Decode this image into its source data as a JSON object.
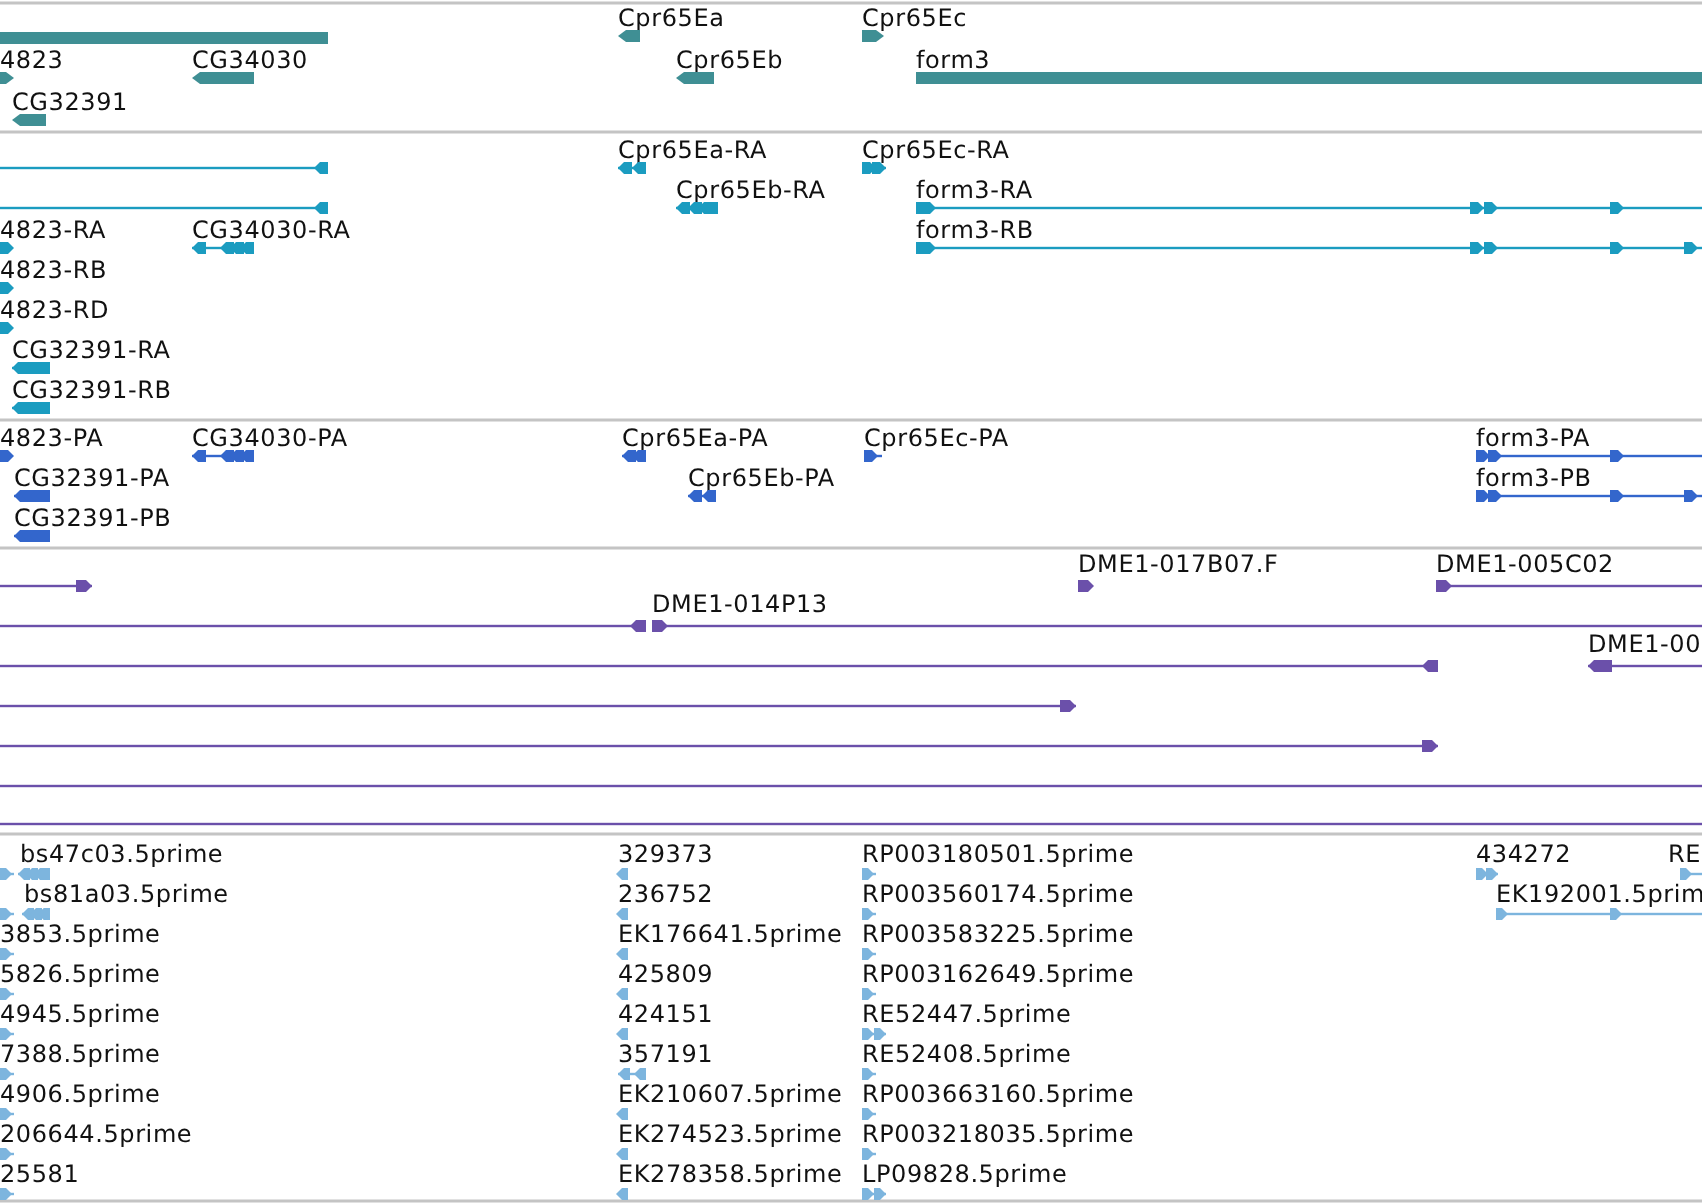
{
  "tracks": [
    {
      "kind": "gene",
      "features": [
        {
          "kind": "plain"
        },
        {
          "label": "4823",
          "kind": "forward"
        },
        {
          "label": "CG34030",
          "kind": "reverse"
        },
        {
          "label": "CG32391",
          "kind": "reverse"
        },
        {
          "label": "Cpr65Ea",
          "kind": "reverse"
        },
        {
          "label": "Cpr65Eb",
          "kind": "reverse"
        },
        {
          "label": "Cpr65Ec",
          "kind": "forward"
        },
        {
          "label": "form3",
          "kind": "plain"
        }
      ]
    },
    {
      "kind": "transcript",
      "features": [
        {
          "kind": "reverse"
        },
        {
          "kind": "reverse"
        },
        {
          "label": "4823-RA",
          "kind": "forward"
        },
        {
          "label": "CG34030-RA",
          "kind": "reverse"
        },
        {
          "label": "4823-RB",
          "kind": "forward"
        },
        {
          "label": "4823-RD",
          "kind": "forward"
        },
        {
          "label": "CG32391-RA",
          "kind": "reverse"
        },
        {
          "label": "CG32391-RB",
          "kind": "reverse"
        },
        {
          "label": "Cpr65Ea-RA",
          "kind": "reverse"
        },
        {
          "label": "Cpr65Eb-RA",
          "kind": "reverse"
        },
        {
          "label": "Cpr65Ec-RA",
          "kind": "forward"
        },
        {
          "label": "form3-RA",
          "kind": "forward"
        },
        {
          "label": "form3-RB",
          "kind": "forward"
        }
      ]
    },
    {
      "kind": "protein",
      "features": [
        {
          "label": "4823-PA",
          "kind": "forward"
        },
        {
          "label": "CG34030-PA",
          "kind": "reverse"
        },
        {
          "label": "CG32391-PA",
          "kind": "reverse"
        },
        {
          "label": "CG32391-PB",
          "kind": "reverse"
        },
        {
          "label": "Cpr65Ea-PA",
          "kind": "reverse"
        },
        {
          "label": "Cpr65Eb-PA",
          "kind": "reverse"
        },
        {
          "label": "Cpr65Ec-PA",
          "kind": "forward"
        },
        {
          "label": "form3-PA",
          "kind": "forward"
        },
        {
          "label": "form3-PB",
          "kind": "forward"
        }
      ]
    },
    {
      "kind": "clone",
      "features": [
        {
          "kind": "forward"
        },
        {
          "label": "DME1-017B07.F",
          "kind": "forward"
        },
        {
          "label": "DME1-005C02",
          "kind": "forward"
        },
        {
          "kind": "reverse"
        },
        {
          "label": "DME1-014P13",
          "kind": "forward"
        },
        {
          "kind": "reverse"
        },
        {
          "label": "DME1-00",
          "kind": "reverse"
        },
        {
          "kind": "forward"
        },
        {
          "kind": "forward"
        },
        {
          "kind": "plain"
        },
        {
          "kind": "plain"
        }
      ]
    },
    {
      "kind": "est",
      "features": [
        {
          "kind": "forward"
        },
        {
          "label": "bs47c03.5prime",
          "kind": "reverse"
        },
        {
          "kind": "forward"
        },
        {
          "label": "bs81a03.5prime",
          "kind": "reverse"
        },
        {
          "label": "3853.5prime",
          "kind": "forward"
        },
        {
          "label": "5826.5prime",
          "kind": "forward"
        },
        {
          "label": "4945.5prime",
          "kind": "forward"
        },
        {
          "label": "7388.5prime",
          "kind": "forward"
        },
        {
          "label": "4906.5prime",
          "kind": "forward"
        },
        {
          "label": "206644.5prime",
          "kind": "forward"
        },
        {
          "label": "25581",
          "kind": "forward"
        },
        {
          "label": "329373",
          "kind": "reverse"
        },
        {
          "label": "236752",
          "kind": "reverse"
        },
        {
          "label": "EK176641.5prime",
          "kind": "reverse"
        },
        {
          "label": "425809",
          "kind": "reverse"
        },
        {
          "label": "424151",
          "kind": "reverse"
        },
        {
          "label": "357191",
          "kind": "reverse"
        },
        {
          "label": "EK210607.5prime",
          "kind": "reverse"
        },
        {
          "label": "EK274523.5prime",
          "kind": "reverse"
        },
        {
          "label": "EK278358.5prime",
          "kind": "reverse"
        },
        {
          "label": "RP003180501.5prime",
          "kind": "forward"
        },
        {
          "label": "RP003560174.5prime",
          "kind": "forward"
        },
        {
          "label": "RP003583225.5prime",
          "kind": "forward"
        },
        {
          "label": "RP003162649.5prime",
          "kind": "forward"
        },
        {
          "label": "RE52447.5prime",
          "kind": "forward"
        },
        {
          "label": "RE52408.5prime",
          "kind": "forward"
        },
        {
          "label": "RP003663160.5prime",
          "kind": "forward"
        },
        {
          "label": "RP003218035.5prime",
          "kind": "forward"
        },
        {
          "label": "LP09828.5prime",
          "kind": "forward"
        },
        {
          "label": "434272",
          "kind": "forward"
        },
        {
          "label": "RE",
          "kind": "forward"
        },
        {
          "label": "EK192001.5prim",
          "kind": "forward"
        }
      ]
    }
  ]
}
